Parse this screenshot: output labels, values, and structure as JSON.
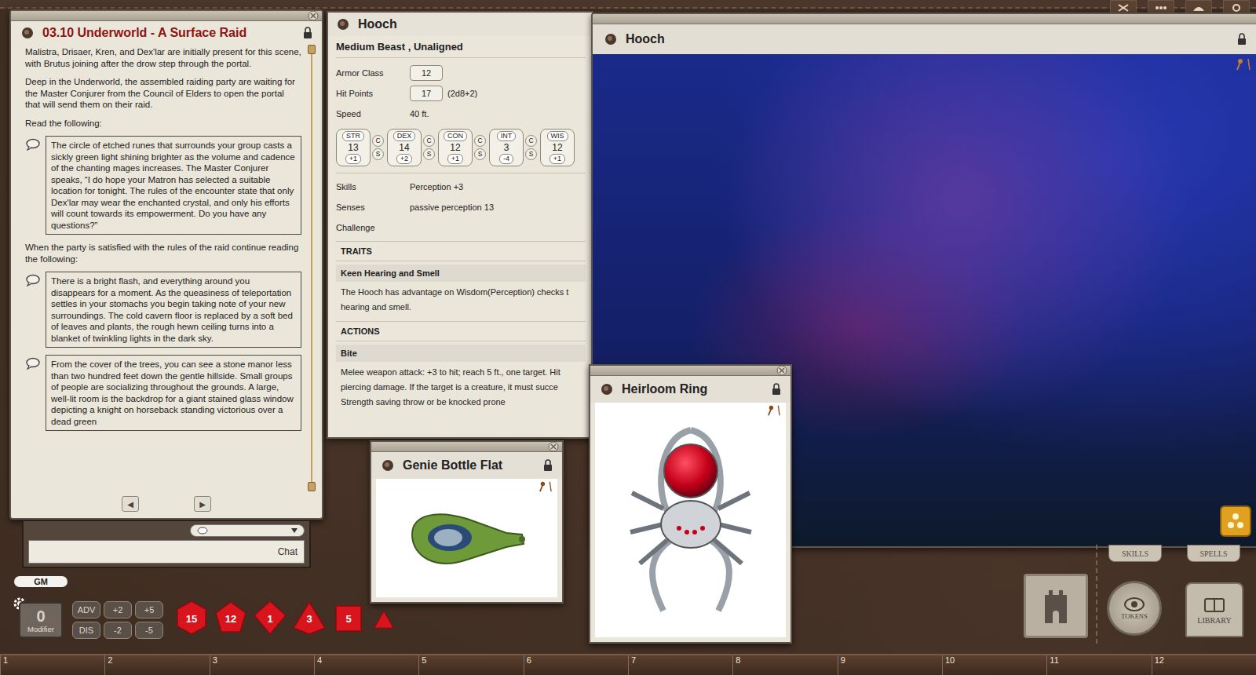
{
  "story": {
    "title": "03.10 Underworld - A Surface Raid",
    "blocks": [
      {
        "kind": "para",
        "text": "Malistra, Drisaer, Kren, and Dex'lar are initially present for this scene, with Brutus joining after the drow step through the portal."
      },
      {
        "kind": "para",
        "text": "Deep in the Underworld, the assembled raiding party are waiting for the Master Conjurer from the Council of Elders to open the portal that will send them on their raid."
      },
      {
        "kind": "para",
        "text": "Read the following:"
      },
      {
        "kind": "read",
        "text": "The circle of etched runes that surrounds your group casts a sickly green light shining brighter as the volume and cadence of the chanting mages increases. The Master Conjurer speaks, “I do hope your Matron has selected a suitable location for tonight. The rules of the encounter state that only Dex'lar may wear the enchanted crystal, and only his efforts will count towards its empowerment. Do you have any questions?”"
      },
      {
        "kind": "para",
        "text": "When the party is satisfied with the rules of the raid continue reading the following:"
      },
      {
        "kind": "read",
        "text": "There is a bright flash, and everything around you disappears for a moment. As the queasiness of teleportation settles in your stomachs you begin taking note of your new surroundings. The cold cavern floor is replaced by a soft bed of leaves and plants, the rough hewn ceiling turns into a blanket of twinkling lights in the dark sky."
      },
      {
        "kind": "read",
        "text": "From the cover of the trees, you can see a stone manor less than two hundred feet down the gentle hillside. Small groups of people are socializing throughout the grounds. A large, well-lit room is the backdrop for a giant stained glass window depicting a knight on horseback standing victorious over a dead green"
      }
    ],
    "nav": [
      "◀",
      "▶"
    ]
  },
  "chat": {
    "label": "Chat"
  },
  "gm_label": "GM",
  "modifier": {
    "value": "0",
    "label": "Modifier"
  },
  "mod_buttons": [
    "ADV",
    "+2",
    "+5",
    "DIS",
    "-2",
    "-5"
  ],
  "dice": [
    {
      "kind": "d20",
      "label": "15"
    },
    {
      "kind": "d12",
      "label": "12"
    },
    {
      "kind": "d10",
      "label": "1"
    },
    {
      "kind": "d8",
      "label": "3"
    },
    {
      "kind": "d6",
      "label": "5"
    },
    {
      "kind": "d4",
      "label": ""
    }
  ],
  "npc": {
    "title": "Hooch",
    "type": "Medium Beast , Unaligned",
    "fields": [
      {
        "label": "Armor Class",
        "value": "12",
        "extra": "",
        "kind": "box"
      },
      {
        "label": "Hit Points",
        "value": "17",
        "extra": "(2d8+2)",
        "kind": "box"
      },
      {
        "label": "Speed",
        "value": "40 ft.",
        "extra": "",
        "kind": "plain"
      }
    ],
    "abilities": [
      {
        "label": "STR",
        "score": "13",
        "mod": "+1",
        "marks": [
          "C",
          "S"
        ]
      },
      {
        "label": "DEX",
        "score": "14",
        "mod": "+2",
        "marks": [
          "C",
          "S"
        ]
      },
      {
        "label": "CON",
        "score": "12",
        "mod": "+1",
        "marks": [
          "C",
          "S"
        ]
      },
      {
        "label": "INT",
        "score": "3",
        "mod": "-4",
        "marks": [
          "C",
          "S"
        ]
      },
      {
        "label": "WIS",
        "score": "12",
        "mod": "+1",
        "marks": []
      }
    ],
    "details": [
      {
        "label": "Skills",
        "value": "Perception +3"
      },
      {
        "label": "Senses",
        "value": "passive perception 13"
      },
      {
        "label": "Challenge",
        "value": ""
      }
    ],
    "sections": [
      {
        "header": "TRAITS",
        "entries": [
          {
            "name": "Keen Hearing and Smell",
            "lines": [
              "The Hooch has advantage on Wisdom(Perception) checks t",
              "hearing and smell."
            ]
          }
        ]
      },
      {
        "header": "ACTIONS",
        "entries": [
          {
            "name": "Bite",
            "lines": [
              "Melee weapon attack: +3 to hit; reach 5 ft., one target. Hit",
              "piercing damage. If the target is a creature, it must succe",
              "Strength saving throw or be knocked prone"
            ]
          }
        ]
      }
    ]
  },
  "image_window": {
    "title": "Hooch"
  },
  "items": [
    {
      "title": "Genie Bottle Flat",
      "kind": "bottle"
    },
    {
      "title": "Heirloom Ring",
      "kind": "ring"
    }
  ],
  "sidebar": {
    "tabs": [
      "SKILLS",
      "SPELLS"
    ],
    "tokens": "TOKENS",
    "library": "LIBRARY"
  },
  "hotkeys": [
    "1",
    "2",
    "3",
    "4",
    "5",
    "6",
    "7",
    "8",
    "9",
    "10",
    "11",
    "12"
  ]
}
